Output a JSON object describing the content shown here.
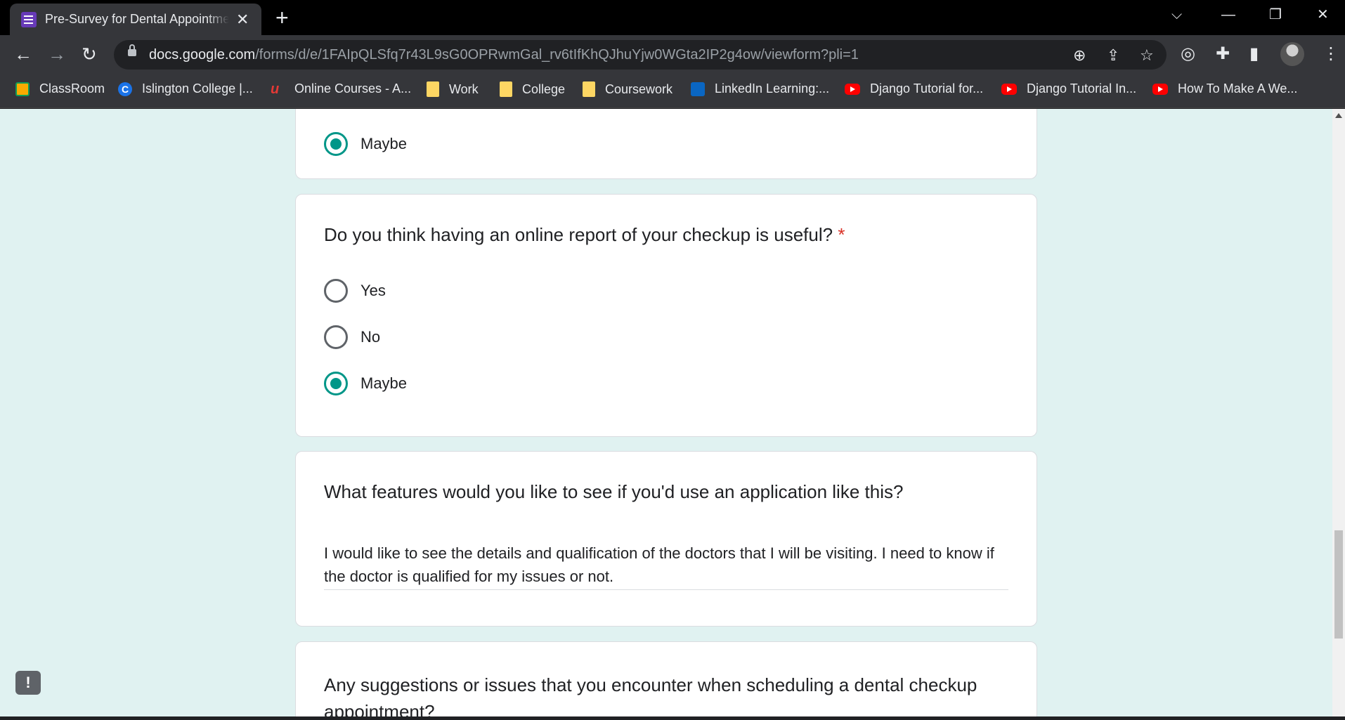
{
  "browser": {
    "tab_title": "Pre-Survey for Dental Appointme",
    "new_tab": "+",
    "close_tab": "✕",
    "window_controls": {
      "tab_search": "⌵",
      "minimize": "—",
      "restore": "❐",
      "close": "✕"
    },
    "url_host": "docs.google.com",
    "url_path": "/forms/d/e/1FAIpQLSfq7r43L9sG0OPRwmGal_rv6tIfKhQJhuYjw0WGta2IP2g4ow/viewform?pli=1",
    "bookmarks": [
      {
        "label": "ClassRoom",
        "icon": "classroom-icon"
      },
      {
        "label": "Islington College |...",
        "icon": "c-icon"
      },
      {
        "label": "Online Courses - A...",
        "icon": "udemy-icon"
      },
      {
        "label": "Work",
        "icon": "folder-icon"
      },
      {
        "label": "College",
        "icon": "folder-icon"
      },
      {
        "label": "Coursework",
        "icon": "folder-icon"
      },
      {
        "label": "LinkedIn Learning:...",
        "icon": "linkedin-learning-icon"
      },
      {
        "label": "Django Tutorial for...",
        "icon": "youtube-icon"
      },
      {
        "label": "Django Tutorial In...",
        "icon": "youtube-icon"
      },
      {
        "label": "How To Make A We...",
        "icon": "youtube-icon"
      }
    ]
  },
  "form": {
    "card0": {
      "options": [
        {
          "label": "Maybe",
          "checked": true
        }
      ]
    },
    "card1": {
      "question": "Do you think having an online report of your checkup is useful?",
      "required_mark": "*",
      "options": [
        {
          "label": "Yes",
          "checked": false
        },
        {
          "label": "No",
          "checked": false
        },
        {
          "label": "Maybe",
          "checked": true
        }
      ]
    },
    "card2": {
      "question": "What features would you like to see if you'd use an application like this?",
      "answer": "I would like to see the details and qualification of the doctors that I will be visiting. I need to know if the doctor is qualified for my issues or not."
    },
    "card3": {
      "question": "Any suggestions or issues that you encounter when scheduling a dental checkup appointment?"
    },
    "feedback_label": "!"
  },
  "colors": {
    "accent": "#009688",
    "page_bg": "#e0f2f1",
    "required": "#d93025"
  }
}
